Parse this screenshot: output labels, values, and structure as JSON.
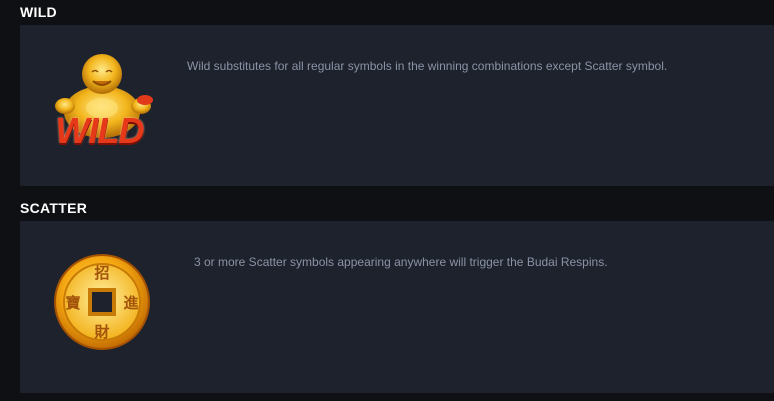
{
  "sections": [
    {
      "title": "WILD",
      "description": "Wild substitutes for all regular symbols in the winning combinations except Scatter symbol.",
      "icon": "buddha-wild-icon",
      "icon_text": "WILD"
    },
    {
      "title": "SCATTER",
      "description": "3 or more Scatter symbols appearing anywhere will trigger the Budai Respins.",
      "icon": "gold-coin-scatter-icon",
      "coin_chars": [
        "招",
        "進",
        "財",
        "寶"
      ]
    }
  ],
  "colors": {
    "background": "#0f1013",
    "panel": "#1e222c",
    "text": "#8a93a6",
    "title": "#ffffff",
    "gold": "#f2b51c",
    "wild_red": "#d8301a"
  }
}
